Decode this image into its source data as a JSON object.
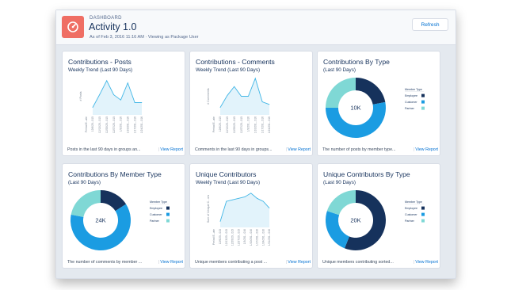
{
  "header": {
    "eyebrow": "DASHBOARD",
    "title": "Activity 1.0",
    "subtitle": "As of Feb 3, 2016 11:16 AM · Viewing as Package User",
    "refresh_label": "Refresh"
  },
  "colors": {
    "accent_blue": "#0070d2",
    "dark_navy": "#16325c",
    "medium_blue": "#1b9ce2",
    "teal": "#7fd8d5",
    "area_fill": "#e2f3fb",
    "area_line": "#41b6e6",
    "logo": "#ef6e64"
  },
  "link_label": "View Report",
  "cards": [
    {
      "title": "Contributions - Posts",
      "subtitle": "Weekly Trend (Last 90 Days)",
      "footer": "Posts in the last 90 days in groups an...",
      "chart_data": {
        "type": "area",
        "ylabel": "# Posts",
        "xlabel": "Period E...ate",
        "x": [
          "12/6/20...015",
          "12/13/20...015",
          "12/20/20...015",
          "12/27/20...015",
          "1/3/201...016",
          "1/10/201...016",
          "1/17/201...016",
          "1/24/201...016"
        ],
        "values": [
          20,
          55,
          92,
          54,
          40,
          86,
          33,
          33
        ]
      }
    },
    {
      "title": "Contributions - Comments",
      "subtitle": "Weekly Trend (Last 90 Days)",
      "footer": "Comments in the last 90 days in groups...",
      "chart_data": {
        "type": "area",
        "ylabel": "# Comments",
        "xlabel": "Period E...ate",
        "x": [
          "12/6/20...015",
          "12/13/20...015",
          "12/20/20...015",
          "12/27/20...015",
          "1/3/201...016",
          "1/10/201...016",
          "1/17/201...016",
          "1/24/201...016"
        ],
        "values": [
          20,
          52,
          76,
          50,
          50,
          98,
          35,
          28
        ]
      }
    },
    {
      "title": "Contributions By Type",
      "subtitle": "(Last 90 Days)",
      "footer": "The number of posts by member type...",
      "chart_data": {
        "type": "pie",
        "center_label": "10K",
        "legend_title": "Member Type",
        "legend_position": "right",
        "slices": [
          {
            "name": "Employee",
            "value": 22,
            "color": "#16325c"
          },
          {
            "name": "Customer",
            "value": 53,
            "color": "#1b9ce2"
          },
          {
            "name": "Partner",
            "value": 25,
            "color": "#7fd8d5"
          }
        ]
      }
    },
    {
      "title": "Contributions By Member Type",
      "subtitle": "(Last 90 Days)",
      "footer": "The number of comments by member ...",
      "chart_data": {
        "type": "pie",
        "center_label": "24K",
        "legend_title": "Member Type",
        "legend_position": "right",
        "slices": [
          {
            "name": "Employee",
            "value": 16,
            "color": "#16325c"
          },
          {
            "name": "Customer",
            "value": 62,
            "color": "#1b9ce2"
          },
          {
            "name": "Partner",
            "value": 22,
            "color": "#7fd8d5"
          }
        ]
      }
    },
    {
      "title": "Unique Contributors",
      "subtitle": "Weekly Trend (Last 90 Days)",
      "footer": "Unique members contributing a post ...",
      "chart_data": {
        "type": "area",
        "ylabel": "Sum of Unique C...ors",
        "xlabel": "Period E...ate",
        "x": [
          "12/6/20...015",
          "12/13/20...015",
          "12/20/20...015",
          "12/27/20...015",
          "1/3/201...016",
          "1/10/201...016",
          "1/17/201...016",
          "1/24/201...016",
          "1/31/201...016"
        ],
        "values": [
          16,
          70,
          74,
          78,
          82,
          92,
          78,
          70,
          52
        ]
      }
    },
    {
      "title": "Unique Contributors By Type",
      "subtitle": "(Last 90 Days)",
      "footer": "Unique members contributing sorted...",
      "chart_data": {
        "type": "pie",
        "center_label": "20K",
        "legend_title": "Member Type",
        "legend_position": "right",
        "slices": [
          {
            "name": "Employee",
            "value": 56,
            "color": "#16325c"
          },
          {
            "name": "Customer",
            "value": 24,
            "color": "#1b9ce2"
          },
          {
            "name": "Partner",
            "value": 20,
            "color": "#7fd8d5"
          }
        ]
      }
    }
  ]
}
